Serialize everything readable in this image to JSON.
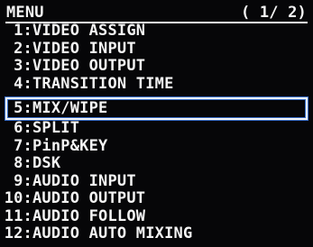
{
  "header": {
    "title": "MENU",
    "page_indicator": "( 1/ 2)"
  },
  "menu": {
    "selected_index": 4,
    "items": [
      {
        "num": "1:",
        "label": "VIDEO ASSIGN"
      },
      {
        "num": "2:",
        "label": "VIDEO INPUT"
      },
      {
        "num": "3:",
        "label": "VIDEO OUTPUT"
      },
      {
        "num": "4:",
        "label": "TRANSITION TIME"
      },
      {
        "num": "5:",
        "label": "MIX/WIPE"
      },
      {
        "num": "6:",
        "label": "SPLIT"
      },
      {
        "num": "7:",
        "label": "PinP&KEY"
      },
      {
        "num": "8:",
        "label": "DSK"
      },
      {
        "num": "9:",
        "label": "AUDIO INPUT"
      },
      {
        "num": "10:",
        "label": "AUDIO OUTPUT"
      },
      {
        "num": "11:",
        "label": "AUDIO FOLLOW"
      },
      {
        "num": "12:",
        "label": "AUDIO AUTO MIXING"
      }
    ]
  }
}
